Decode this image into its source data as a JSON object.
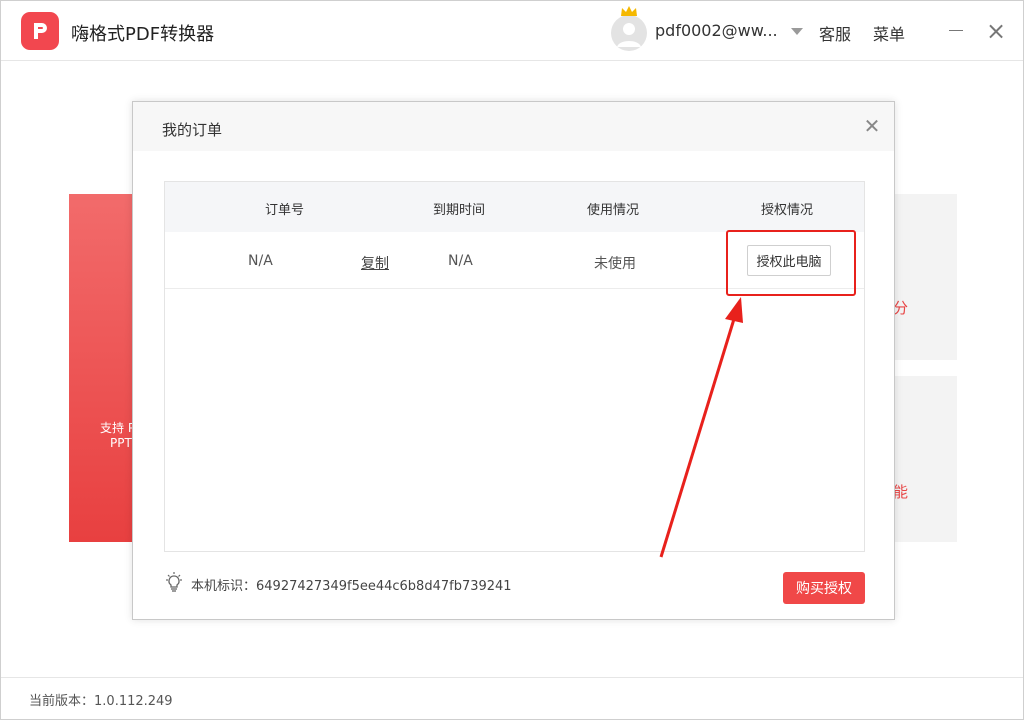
{
  "app": {
    "title": "嗨格式PDF转换器",
    "user_email": "pdf0002@ww...",
    "service_label": "客服",
    "menu_label": "菜单",
    "brand_color": "#f2474f"
  },
  "background": {
    "red_card_text": "支持 P\nPPT",
    "gray_card_text_1": "分",
    "gray_card_text_2": "能"
  },
  "modal": {
    "title": "我的订单",
    "columns": [
      "订单号",
      "到期时间",
      "使用情况",
      "授权情况"
    ],
    "rows": [
      {
        "order_no": "N/A",
        "copy_label": "复制",
        "expiry": "N/A",
        "usage": "未使用",
        "auth_button_label": "授权此电脑"
      }
    ],
    "machine_id_label": "本机标识：",
    "machine_id": "64927427349f5ee44c6b8d47fb739241",
    "buy_button_label": "购买授权"
  },
  "footer": {
    "version_label": "当前版本：",
    "version": "1.0.112.249"
  },
  "annotation_color": "#e8211c"
}
